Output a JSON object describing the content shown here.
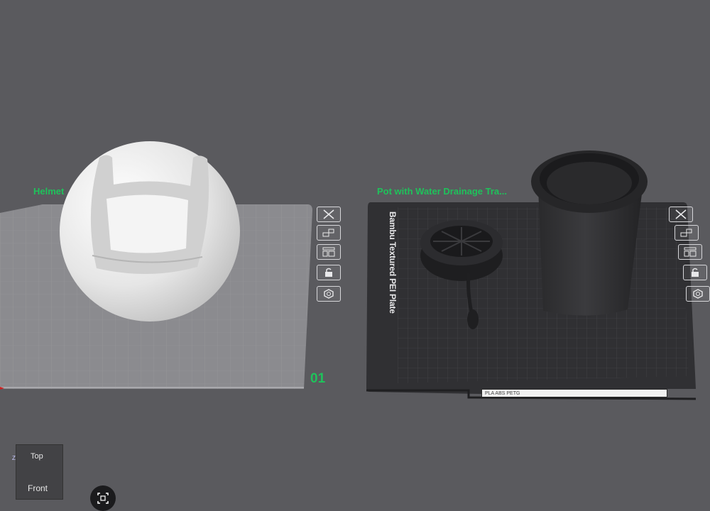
{
  "plates": [
    {
      "title": "Helmet",
      "number": "01"
    },
    {
      "title": "Pot with Water Drainage Tra...",
      "plate_type_label": "Bambu Textured PEI Plate",
      "filament_label": "PLA ABS PETG"
    }
  ],
  "toolbar_icons": [
    "close-icon",
    "auto-arrange-icon",
    "layout-icon",
    "lock-icon",
    "settings-icon"
  ],
  "view_cube": {
    "top_label": "Top",
    "front_label": "Front",
    "axis_label": "Z"
  },
  "colors": {
    "accent": "#1fc25b",
    "background": "#5a5a5e",
    "light_plate": "#8a8a8e",
    "dark_plate": "#2f2f32"
  }
}
